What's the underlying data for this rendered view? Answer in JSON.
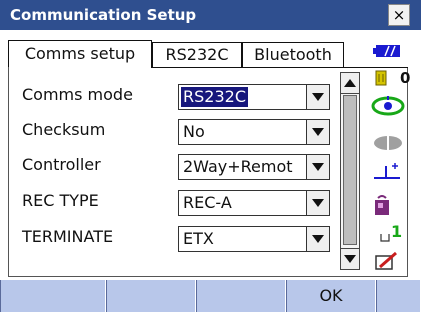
{
  "window": {
    "title": "Communication Setup",
    "close_label": "×"
  },
  "tabs": [
    {
      "label": "Comms setup",
      "active": true
    },
    {
      "label": "RS232C",
      "active": false
    },
    {
      "label": "Bluetooth",
      "active": false
    }
  ],
  "fields": [
    {
      "label": "Comms mode",
      "value": "RS232C",
      "selected": true
    },
    {
      "label": "Checksum",
      "value": "No",
      "selected": false
    },
    {
      "label": "Controller",
      "value": "2Way+Remot",
      "selected": false
    },
    {
      "label": "REC TYPE",
      "value": "REC-A",
      "selected": false
    },
    {
      "label": "TERMINATE",
      "value": "ETX",
      "selected": false
    }
  ],
  "status": {
    "battery_icon": "battery-icon",
    "memory_count": "0",
    "target_icon": "target-icon",
    "prism_icon": "prism-icon",
    "tilt_icon": "tilt-icon",
    "bag_icon": "bag-icon",
    "input_mode": "1",
    "pencil_icon": "pencil-icon"
  },
  "softkeys": [
    "",
    "",
    "",
    "OK",
    ""
  ],
  "colors": {
    "title_bar": "#2f4f8f",
    "selection": "#17177c",
    "softkey_bar": "#b8c7ea",
    "status_blue": "#1a1ad0"
  }
}
